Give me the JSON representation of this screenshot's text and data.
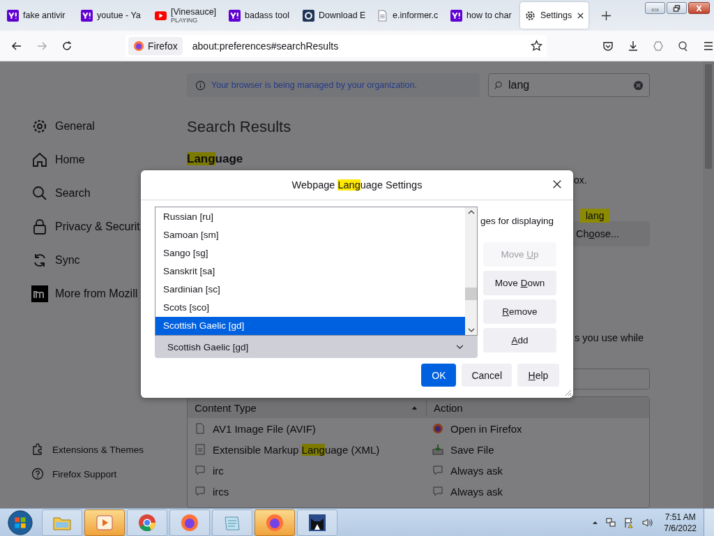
{
  "browser": {
    "tabs": [
      {
        "title": "fake antivir",
        "kind": "yahoo",
        "selected": false
      },
      {
        "title": "youtue - Ya",
        "kind": "yahoo",
        "selected": false
      },
      {
        "title": "[Vinesauce]",
        "subtitle": "PLAYING",
        "kind": "video",
        "selected": false
      },
      {
        "title": "badass tool",
        "kind": "yahoo",
        "selected": false
      },
      {
        "title": "Download E",
        "kind": "circle",
        "selected": false
      },
      {
        "title": "e.informer.c",
        "kind": "page",
        "selected": false
      },
      {
        "title": "how to char",
        "kind": "yahoo",
        "selected": false
      },
      {
        "title": "Settings",
        "kind": "gear",
        "selected": true
      }
    ],
    "identity": "Firefox",
    "url": "about:preferences#searchResults"
  },
  "page": {
    "notice": "Your browser is being managed by your organization.",
    "search": {
      "value": "lang"
    },
    "sidebar": {
      "items": [
        {
          "label": "General",
          "kind": "gear"
        },
        {
          "label": "Home",
          "kind": "home"
        },
        {
          "label": "Search",
          "kind": "search"
        },
        {
          "label": "Privacy & Securit",
          "kind": "lock"
        },
        {
          "label": "Sync",
          "kind": "sync"
        },
        {
          "label": "More from Mozill",
          "kind": "m"
        }
      ],
      "footer": [
        {
          "label": "Extensions & Themes",
          "kind": "puzzle"
        },
        {
          "label": "Firefox Support",
          "kind": "help"
        }
      ]
    },
    "heading": "Search Results",
    "section": [
      {
        "text": "Lang",
        "highlight": true
      },
      {
        "text": "uage",
        "highlight": false
      }
    ],
    "fragment_1": "ox.",
    "tooltip": "lang",
    "choose_button": [
      {
        "text": "Ch",
        "underline": false
      },
      {
        "text": "o",
        "underline": true
      },
      {
        "text": "ose...",
        "underline": false
      }
    ],
    "fragment_2": "s you use while",
    "table": {
      "columns": [
        {
          "label": "Content Type",
          "sorted": true
        },
        {
          "label": "Action",
          "sorted": false
        }
      ],
      "rows": [
        {
          "type": {
            "kind": "file",
            "parts": [
              {
                "text": "AV1 Image File (AVIF)",
                "highlight": false
              }
            ]
          },
          "action": {
            "kind": "firefox",
            "text": "Open in Firefox"
          }
        },
        {
          "type": {
            "kind": "xml",
            "parts": [
              {
                "text": "Extensible Markup ",
                "highlight": false
              },
              {
                "text": "Lang",
                "highlight": true
              },
              {
                "text": "uage (XML)",
                "highlight": false
              }
            ]
          },
          "action": {
            "kind": "save",
            "text": "Save File"
          }
        },
        {
          "type": {
            "kind": "chat",
            "parts": [
              {
                "text": "irc",
                "highlight": false
              }
            ]
          },
          "action": {
            "kind": "chat",
            "text": "Always ask"
          }
        },
        {
          "type": {
            "kind": "chat",
            "parts": [
              {
                "text": "ircs",
                "highlight": false
              }
            ]
          },
          "action": {
            "kind": "chat",
            "text": "Always ask"
          }
        }
      ]
    }
  },
  "dialog": {
    "title": [
      {
        "text": "Webpage ",
        "highlight": false
      },
      {
        "text": "Lang",
        "highlight": true
      },
      {
        "text": "uage Settings",
        "highlight": false
      }
    ],
    "languages": [
      {
        "label": "Russian [ru]",
        "selected": false
      },
      {
        "label": "Samoan [sm]",
        "selected": false
      },
      {
        "label": "Sango [sg]",
        "selected": false
      },
      {
        "label": "Sanskrit [sa]",
        "selected": false
      },
      {
        "label": "Sardinian [sc]",
        "selected": false
      },
      {
        "label": "Scots [sco]",
        "selected": false
      },
      {
        "label": "Scottish Gaelic [gd]",
        "selected": true
      }
    ],
    "select_value": "Scottish Gaelic [gd]",
    "fragment": "ges for displaying",
    "side_buttons": [
      {
        "label": [
          {
            "text": "Move ",
            "underline": false
          },
          {
            "text": "U",
            "underline": true
          },
          {
            "text": "p",
            "underline": false
          }
        ],
        "disabled": true
      },
      {
        "label": [
          {
            "text": "Move ",
            "underline": false
          },
          {
            "text": "D",
            "underline": true
          },
          {
            "text": "own",
            "underline": false
          }
        ],
        "disabled": false
      },
      {
        "label": [
          {
            "text": "R",
            "underline": true
          },
          {
            "text": "emove",
            "underline": false
          }
        ],
        "disabled": false
      },
      {
        "label": [
          {
            "text": "A",
            "underline": true
          },
          {
            "text": "dd",
            "underline": false
          }
        ],
        "disabled": false
      }
    ],
    "footer_buttons": [
      {
        "label": [
          {
            "text": "OK",
            "underline": false
          }
        ],
        "kind": "primary"
      },
      {
        "label": [
          {
            "text": "Cancel",
            "underline": false
          }
        ],
        "kind": "normal"
      },
      {
        "label": [
          {
            "text": "H",
            "underline": true
          },
          {
            "text": "elp",
            "underline": false
          }
        ],
        "kind": "normal"
      }
    ]
  },
  "taskbar": {
    "apps": [
      {
        "kind": "folder",
        "highlighted": false
      },
      {
        "kind": "media",
        "highlighted": true
      },
      {
        "kind": "chrome",
        "highlighted": false
      },
      {
        "kind": "firefox",
        "highlighted": false
      },
      {
        "kind": "notepad",
        "highlighted": false
      },
      {
        "kind": "firefox",
        "highlighted": true
      },
      {
        "kind": "cat",
        "highlighted": false
      }
    ],
    "time": "7:51 AM",
    "date": "7/6/2022"
  }
}
